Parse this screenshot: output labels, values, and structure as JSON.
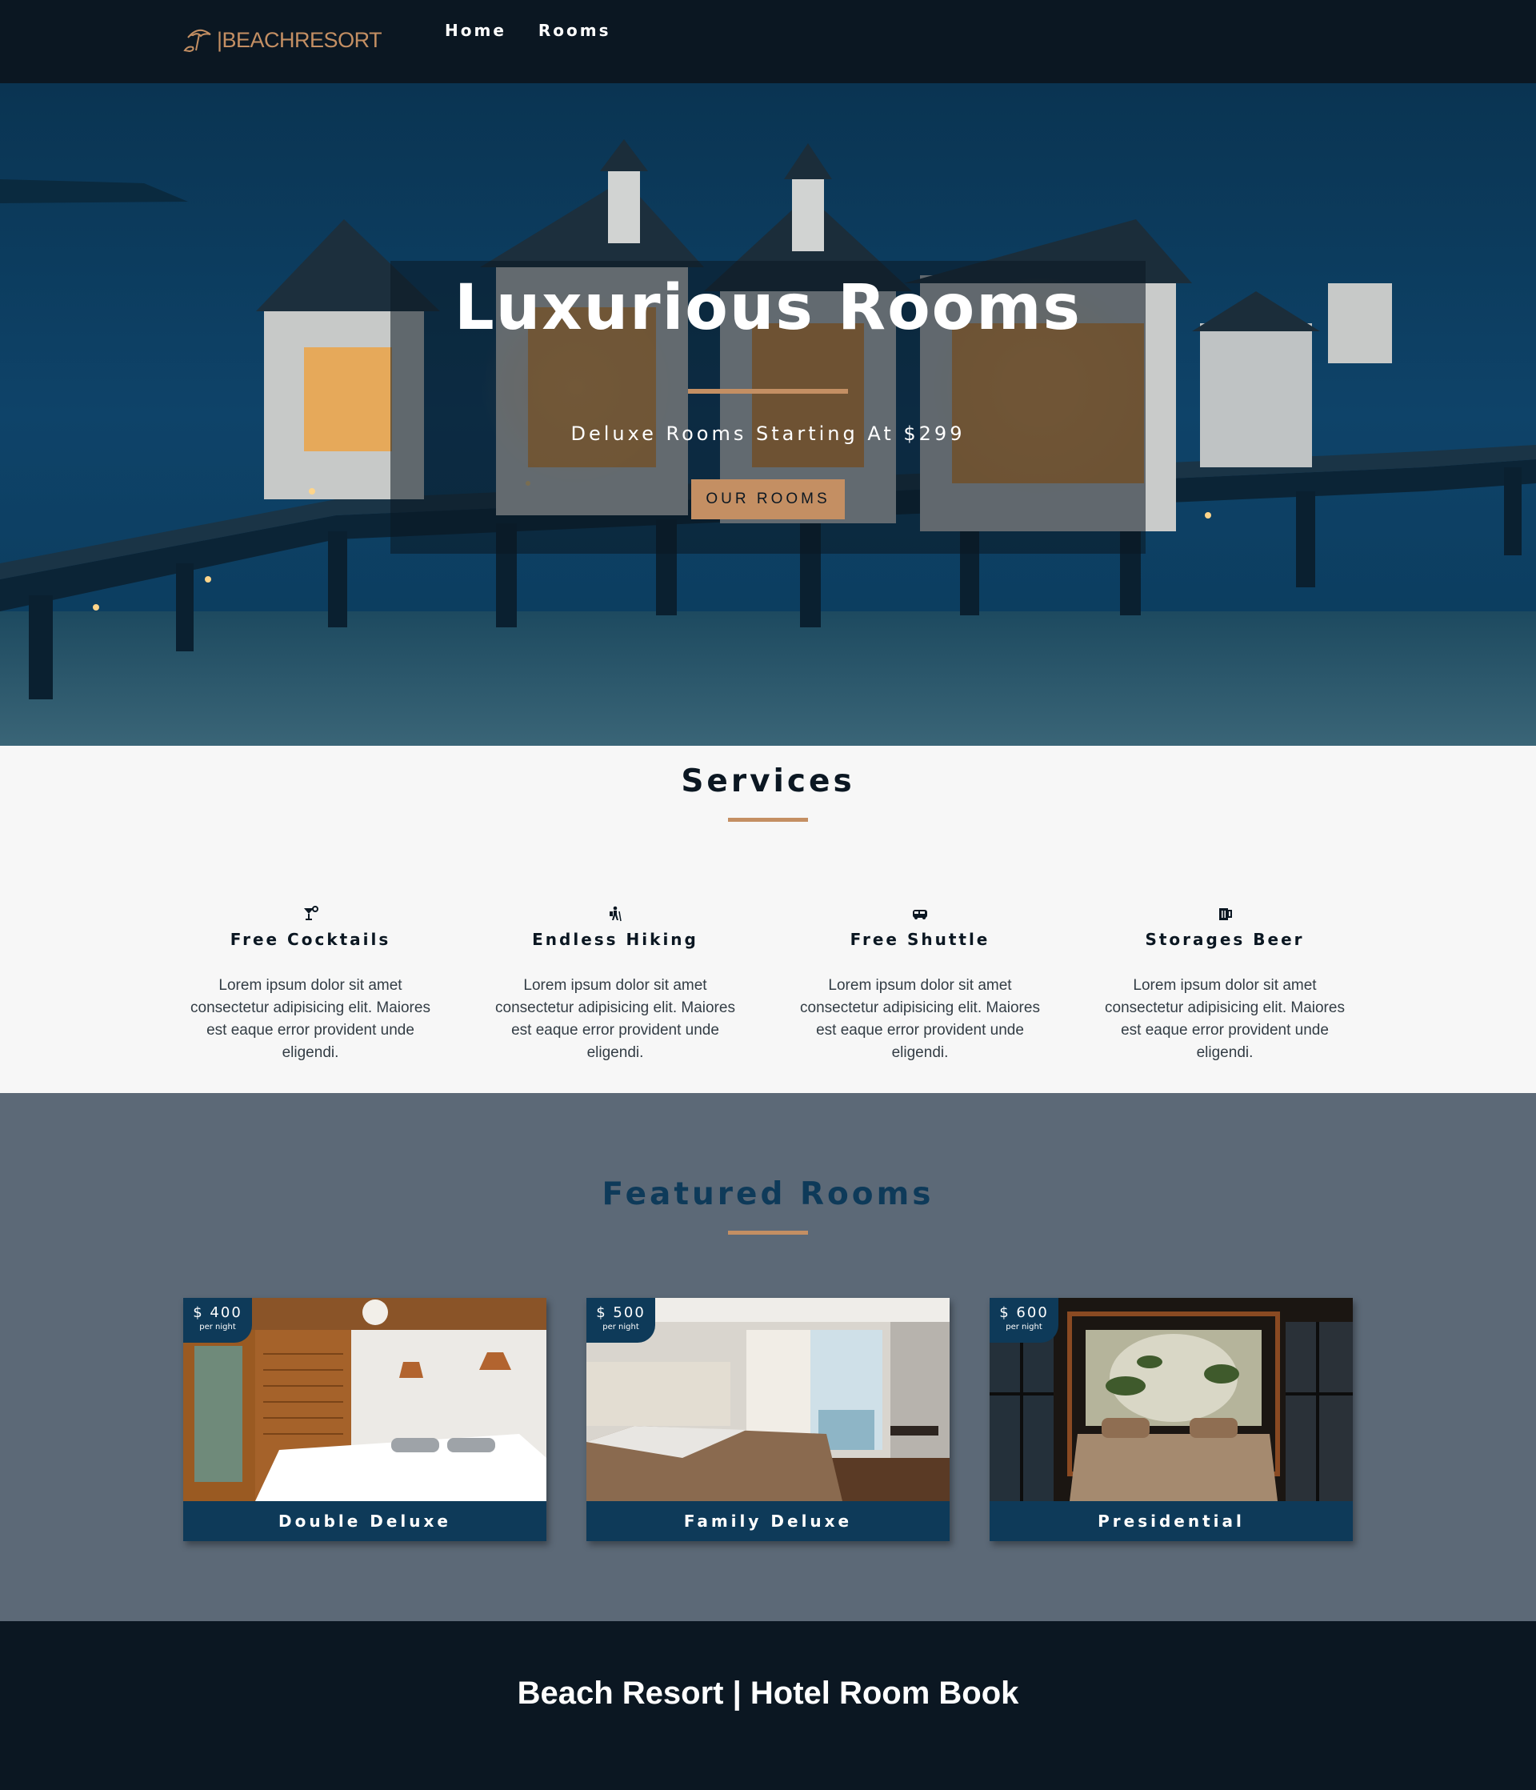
{
  "nav": {
    "logo": {
      "part1": "BEACH",
      "part2": "RESORT",
      "icon": "umbrella-icon"
    },
    "links": [
      "Home",
      "Rooms"
    ]
  },
  "hero": {
    "title": "Luxurious Rooms",
    "subtitle": "Deluxe Rooms Starting At $299",
    "button": "OUR ROOMS"
  },
  "services": {
    "title": "Services",
    "items": [
      {
        "icon": "cocktail-icon",
        "title": "Free Cocktails",
        "text": "Lorem ipsum dolor sit amet consectetur adipisicing elit. Maiores est eaque error provident unde eligendi."
      },
      {
        "icon": "hiking-icon",
        "title": "Endless Hiking",
        "text": "Lorem ipsum dolor sit amet consectetur adipisicing elit. Maiores est eaque error provident unde eligendi."
      },
      {
        "icon": "shuttle-icon",
        "title": "Free Shuttle",
        "text": "Lorem ipsum dolor sit amet consectetur adipisicing elit. Maiores est eaque error provident unde eligendi."
      },
      {
        "icon": "beer-icon",
        "title": "Storages Beer",
        "text": "Lorem ipsum dolor sit amet consectetur adipisicing elit. Maiores est eaque error provident unde eligendi."
      }
    ]
  },
  "featured": {
    "title": "Featured Rooms",
    "rooms": [
      {
        "price": "$ 400",
        "unit": "per night",
        "name": "Double Deluxe"
      },
      {
        "price": "$ 500",
        "unit": "per night",
        "name": "Family Deluxe"
      },
      {
        "price": "$ 600",
        "unit": "per night",
        "name": "Presidential"
      }
    ]
  },
  "footer": {
    "text": "Beach Resort | Hotel Room Book"
  },
  "colors": {
    "dark": "#0b1722",
    "accent": "#c48f63",
    "featured_bg": "#5c6977",
    "room_blue": "#0e3a59"
  }
}
